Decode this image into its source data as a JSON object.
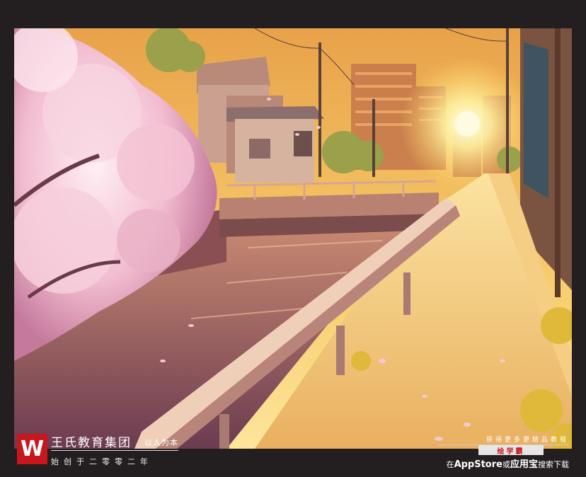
{
  "brand": {
    "logo_letter": "W",
    "name": "王氏教育集团",
    "slogan": "以人为本",
    "founded": "始创于二零零二年"
  },
  "promo": {
    "tagline": "获得更多更精品教程",
    "app_name": "绘学霸",
    "search_prefix": "在",
    "store_1": "AppStore",
    "connector": "或",
    "store_2": "应用宝",
    "search_suffix": "搜索下载"
  },
  "colors": {
    "frame": "#231f20",
    "brand_red": "#c8161d",
    "sky_top": "#f0b04a",
    "sky_horizon": "#fbe088",
    "blossom": "#f6c9d8",
    "water": "#8a5560"
  },
  "icons": [
    "wangshi-logo-icon"
  ]
}
